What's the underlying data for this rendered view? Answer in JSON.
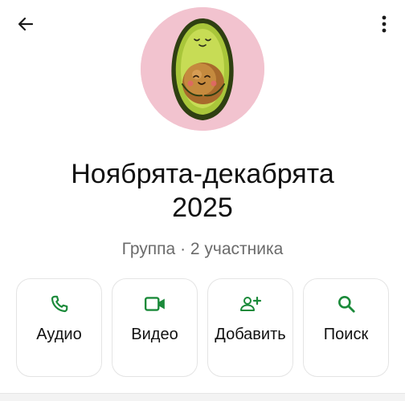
{
  "header": {
    "back_icon": "arrow-left-icon",
    "menu_icon": "more-vertical-icon"
  },
  "avatar": {
    "description_icon": "avocado-avatar",
    "background_color": "#f2c3cf"
  },
  "group": {
    "title_line1": "Ноябрята-декабрята",
    "title_line2": "2025",
    "subtitle": "Группа · 2 участника"
  },
  "actions": [
    {
      "label": "Аудио",
      "icon": "phone-icon"
    },
    {
      "label": "Видео",
      "icon": "video-icon"
    },
    {
      "label": "Добавить",
      "icon": "add-person-icon"
    },
    {
      "label": "Поиск",
      "icon": "search-icon"
    }
  ],
  "colors": {
    "accent": "#1b8a3a",
    "text": "#111111",
    "muted": "#6b6b6b"
  }
}
